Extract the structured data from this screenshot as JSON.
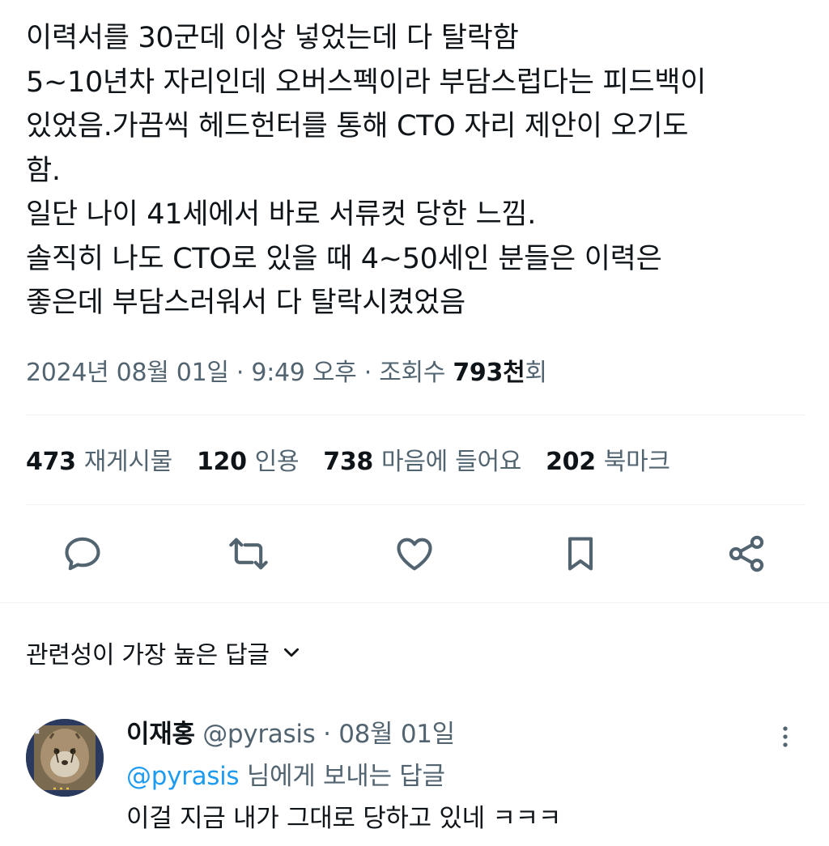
{
  "tweet": {
    "lines": [
      "이력서를 30군데 이상 넣었는데 다 탈락함",
      "5~10년차 자리인데 오버스펙이라 부담스럽다는 피드백이",
      "있었음.가끔씩 헤드헌터를 통해 CTO 자리 제안이 오기도",
      "함.",
      "일단 나이 41세에서 바로 서류컷 당한 느낌.",
      "솔직히 나도 CTO로 있을 때 4~50세인 분들은 이력은",
      "좋은데 부담스러워서 다 탈락시켰었음"
    ],
    "date": "2024년 08월 01일",
    "separator": "·",
    "time": "9:49 오후",
    "views_label": "조회수",
    "views_count": "793천",
    "views_suffix": "회"
  },
  "stats": [
    {
      "num": "473",
      "label": "재게시물"
    },
    {
      "num": "120",
      "label": "인용"
    },
    {
      "num": "738",
      "label": "마음에 들어요"
    },
    {
      "num": "202",
      "label": "북마크"
    }
  ],
  "actions": [
    "reply-icon",
    "retweet-icon",
    "heart-icon",
    "bookmark-icon",
    "share-icon"
  ],
  "colors": {
    "text": "#0f1419",
    "secondary": "#536471",
    "accent": "#1d9bf0",
    "divider": "#eff3f4"
  },
  "replies_sort": {
    "label": "관련성이 가장 높은 답글",
    "icon": "chevron-down-icon"
  },
  "reply": {
    "author": "이재홍",
    "handle": "@pyrasis",
    "separator": "·",
    "date": "08월 01일",
    "mention": "@pyrasis",
    "reply_to_suffix": " 님에게 보내는 답글",
    "text": "이걸 지금 내가 그대로 당하고 있네 ㅋㅋㅋ",
    "more_icon": "more-vertical-icon"
  }
}
